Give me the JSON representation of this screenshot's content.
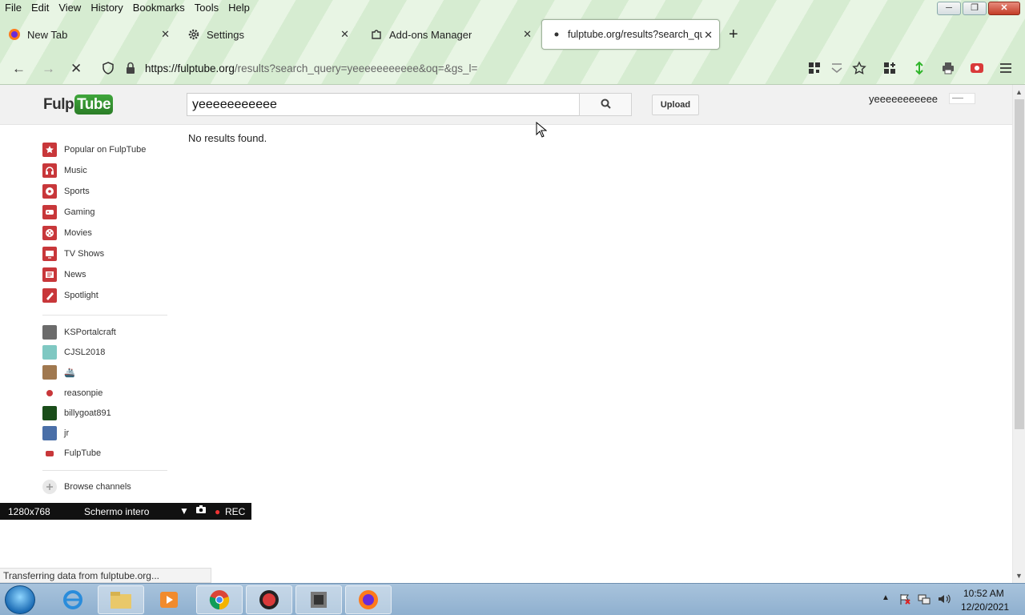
{
  "menubar": {
    "items": [
      "File",
      "Edit",
      "View",
      "History",
      "Bookmarks",
      "Tools",
      "Help"
    ]
  },
  "tabs": [
    {
      "label": "New Tab",
      "icon": "firefox-icon"
    },
    {
      "label": "Settings",
      "icon": "gear-icon"
    },
    {
      "label": "Add-ons Manager",
      "icon": "puzzle-icon"
    },
    {
      "label": "fulptube.org/results?search_query",
      "icon": "loading-dot-icon",
      "active": true
    }
  ],
  "navbar": {
    "url_host": "https://fulptube.org",
    "url_path": "/results?search_query=yeeeeeeeeeee&oq=&gs_l="
  },
  "site": {
    "logo_part1": "Fulp",
    "logo_part2": "Tube",
    "search_value": "yeeeeeeeeeee",
    "upload_label": "Upload",
    "username": "yeeeeeeeeeee",
    "no_results": "No results found."
  },
  "sidebar": {
    "guide": [
      {
        "label": "Popular on FulpTube",
        "icon": "star-icon"
      },
      {
        "label": "Music",
        "icon": "headphones-icon"
      },
      {
        "label": "Sports",
        "icon": "soccer-ball-icon"
      },
      {
        "label": "Gaming",
        "icon": "gamepad-icon"
      },
      {
        "label": "Movies",
        "icon": "film-reel-icon"
      },
      {
        "label": "TV Shows",
        "icon": "tv-icon"
      },
      {
        "label": "News",
        "icon": "newspaper-icon"
      },
      {
        "label": "Spotlight",
        "icon": "spotlight-icon"
      }
    ],
    "subscriptions": [
      {
        "label": "KSPortalcraft",
        "color": "#6b6b6b"
      },
      {
        "label": "CJSL2018",
        "color": "#7fc8c2"
      },
      {
        "label": "🚢",
        "color": "#a0784f"
      },
      {
        "label": "reasonpie",
        "color": "#c8373a"
      },
      {
        "label": "billygoat891",
        "color": "#1a4d1a"
      },
      {
        "label": "jr",
        "color": "#4a6fa8"
      },
      {
        "label": "FulpTube",
        "color": "#c8373a"
      }
    ],
    "browse_channels": "Browse channels"
  },
  "recorder": {
    "resolution": "1280x768",
    "mode": "Schermo intero",
    "rec_label": "REC"
  },
  "statusbar": {
    "text": "Transferring data from fulptube.org..."
  },
  "taskbar": {
    "time": "10:52 AM",
    "date": "12/20/2021"
  },
  "colors": {
    "brand_green": "#2b7d27",
    "brand_red": "#c8373a",
    "chrome_green": "#d6ecd1"
  }
}
